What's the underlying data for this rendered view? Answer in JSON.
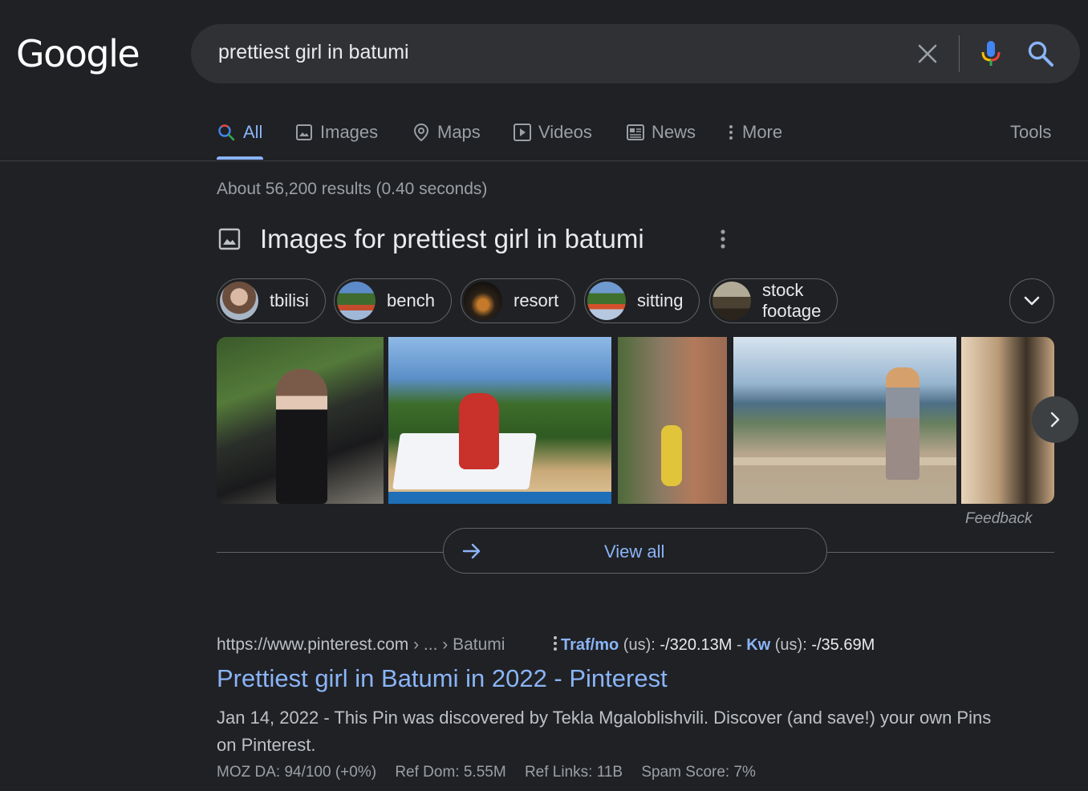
{
  "logo": "Google",
  "search": {
    "query": "prettiest girl in batumi",
    "icons": [
      "close-icon",
      "mic-icon",
      "search-icon"
    ]
  },
  "tabs": [
    {
      "label": "All",
      "icon": "search-icon",
      "active": true
    },
    {
      "label": "Images",
      "icon": "image-icon"
    },
    {
      "label": "Maps",
      "icon": "map-pin-icon"
    },
    {
      "label": "Videos",
      "icon": "play-icon"
    },
    {
      "label": "News",
      "icon": "newspaper-icon"
    },
    {
      "label": "More",
      "icon": "kebab-icon"
    }
  ],
  "tools_label": "Tools",
  "stats": "About 56,200 results (0.40 seconds)",
  "images_section": {
    "title": "Images for prettiest girl in batumi",
    "chips": [
      "tbilisi",
      "bench",
      "resort",
      "sitting",
      "stock footage"
    ],
    "feedback": "Feedback",
    "view_all": "View all"
  },
  "result": {
    "url": "https://www.pinterest.com",
    "crumb": " › ... › Batumi",
    "seo": {
      "traf_key": "Traf/mo",
      "traf_region": " (us): ",
      "traf_val": "-/320.13M",
      "sep": " - ",
      "kw_key": "Kw",
      "kw_region": " (us): ",
      "kw_val": "-/35.69M"
    },
    "title": "Prettiest girl in Batumi in 2022 - Pinterest",
    "date": "Jan 14, 2022",
    "snippet": " - This Pin was discovered by Tekla Mgaloblishvili. Discover (and save!) your own Pins on Pinterest.",
    "metrics": [
      "MOZ DA: 94/100 (+0%)",
      "Ref Dom: 5.55M",
      "Ref Links: 11B",
      "Spam Score: 7%"
    ]
  },
  "colors": {
    "background": "#202124",
    "link": "#8ab4f8",
    "text": "#bdc1c6"
  }
}
